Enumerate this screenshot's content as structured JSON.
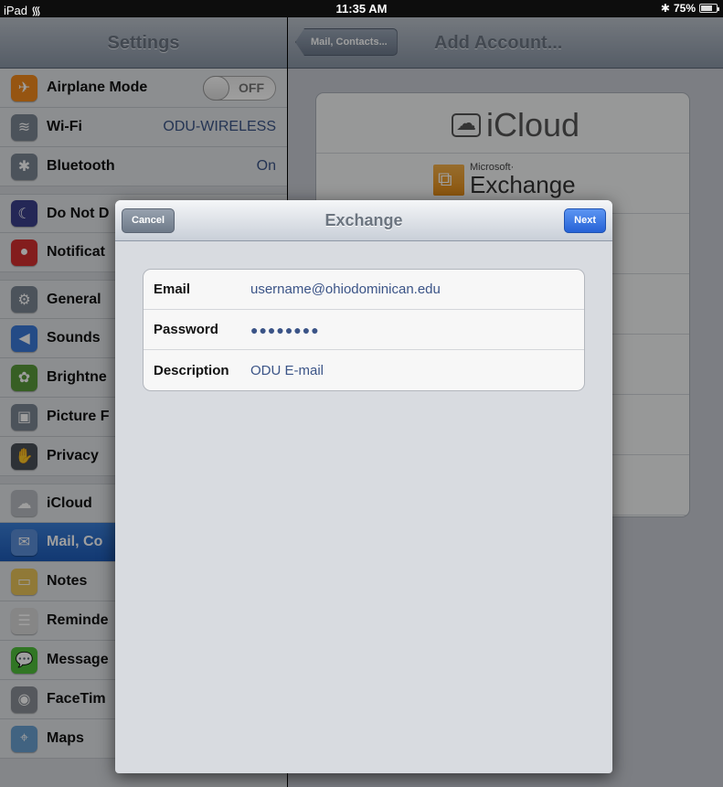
{
  "status_bar": {
    "device": "iPad",
    "time": "11:35 AM",
    "battery": "75%",
    "battery_level": 0.75
  },
  "master": {
    "title": "Settings",
    "rows": [
      {
        "label": "Airplane Mode",
        "toggle": "OFF",
        "icon": "airplane-icon",
        "color": "#f28a1c"
      },
      {
        "label": "Wi-Fi",
        "value": "ODU-WIRELESS",
        "icon": "wifi-icon",
        "color": "#7b8694"
      },
      {
        "label": "Bluetooth",
        "value": "On",
        "icon": "bluetooth-icon",
        "color": "#7b8694"
      },
      {
        "label": "Do Not D",
        "icon": "moon-icon",
        "color": "#3b3f8c",
        "sep": true
      },
      {
        "label": "Notificat",
        "icon": "notifications-icon",
        "color": "#d43030"
      },
      {
        "label": "General",
        "icon": "gear-icon",
        "color": "#7b8694",
        "sep": true
      },
      {
        "label": "Sounds",
        "icon": "speaker-icon",
        "color": "#3a7ad8"
      },
      {
        "label": "Brightne",
        "icon": "flower-icon",
        "color": "#5a9a3a"
      },
      {
        "label": "Picture F",
        "icon": "picture-frame-icon",
        "color": "#7b8694"
      },
      {
        "label": "Privacy",
        "icon": "hand-icon",
        "color": "#4a4f57"
      },
      {
        "label": "iCloud",
        "icon": "cloud-icon",
        "color": "#b8bcc2",
        "sep": true
      },
      {
        "label": "Mail, Co",
        "icon": "mail-icon",
        "color": "#5b8fd8",
        "selected": true
      },
      {
        "label": "Notes",
        "icon": "notes-icon",
        "color": "#e8c45a"
      },
      {
        "label": "Reminde",
        "icon": "reminders-icon",
        "color": "#d8d8d8"
      },
      {
        "label": "Message",
        "icon": "messages-icon",
        "color": "#4fbf3a"
      },
      {
        "label": "FaceTim",
        "icon": "facetime-icon",
        "color": "#8a8f96"
      },
      {
        "label": "Maps",
        "icon": "maps-icon",
        "color": "#6aa0d0"
      }
    ]
  },
  "detail": {
    "back_label": "Mail, Contacts...",
    "title": "Add Account...",
    "providers": {
      "icloud": "iCloud",
      "exchange_brand": "Microsoft·",
      "exchange": "Exchange"
    }
  },
  "sheet": {
    "title": "Exchange",
    "cancel": "Cancel",
    "next": "Next",
    "fields": {
      "email_label": "Email",
      "email_value": "username@ohiodominican.edu",
      "password_label": "Password",
      "password_value": "●●●●●●●●",
      "description_label": "Description",
      "description_value": "ODU E-mail"
    }
  }
}
